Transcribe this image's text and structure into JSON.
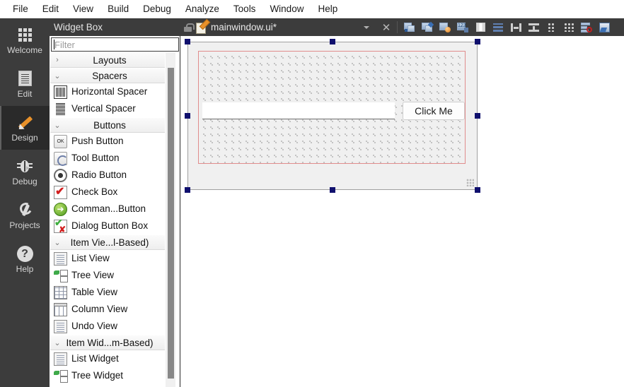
{
  "menubar": {
    "items": [
      {
        "label": "File"
      },
      {
        "label": "Edit"
      },
      {
        "label": "View"
      },
      {
        "label": "Build"
      },
      {
        "label": "Debug"
      },
      {
        "label": "Analyze"
      },
      {
        "label": "Tools"
      },
      {
        "label": "Window"
      },
      {
        "label": "Help"
      }
    ]
  },
  "modebar": {
    "items": [
      {
        "label": "Welcome",
        "icon": "grid-icon",
        "active": false
      },
      {
        "label": "Edit",
        "icon": "document-icon",
        "active": false
      },
      {
        "label": "Design",
        "icon": "pencil-icon",
        "active": true
      },
      {
        "label": "Debug",
        "icon": "bug-icon",
        "active": false
      },
      {
        "label": "Projects",
        "icon": "wrench-icon",
        "active": false
      },
      {
        "label": "Help",
        "icon": "question-mark-icon",
        "active": false
      }
    ]
  },
  "widgetbox": {
    "title": "Widget Box",
    "filter_placeholder": "Filter",
    "filter_value": "",
    "entries": [
      {
        "kind": "section",
        "label": "Layouts",
        "expanded": false,
        "chevron": "›"
      },
      {
        "kind": "section",
        "label": "Spacers",
        "expanded": true,
        "chevron": "⌄"
      },
      {
        "kind": "item",
        "label": "Horizontal Spacer",
        "icon": "horizontal-spacer-icon"
      },
      {
        "kind": "item",
        "label": "Vertical Spacer",
        "icon": "vertical-spacer-icon"
      },
      {
        "kind": "section",
        "label": "Buttons",
        "expanded": true,
        "chevron": "⌄"
      },
      {
        "kind": "item",
        "label": "Push Button",
        "icon": "push-button-icon"
      },
      {
        "kind": "item",
        "label": "Tool Button",
        "icon": "tool-button-icon"
      },
      {
        "kind": "item",
        "label": "Radio Button",
        "icon": "radio-button-icon"
      },
      {
        "kind": "item",
        "label": "Check Box",
        "icon": "check-box-icon"
      },
      {
        "kind": "item",
        "label": "Comman...Button",
        "icon": "command-link-button-icon"
      },
      {
        "kind": "item",
        "label": "Dialog Button Box",
        "icon": "dialog-button-box-icon"
      },
      {
        "kind": "section",
        "label": "Item Vie...l-Based)",
        "expanded": true,
        "chevron": "⌄"
      },
      {
        "kind": "item",
        "label": "List View",
        "icon": "list-view-icon"
      },
      {
        "kind": "item",
        "label": "Tree View",
        "icon": "tree-view-icon"
      },
      {
        "kind": "item",
        "label": "Table View",
        "icon": "table-view-icon"
      },
      {
        "kind": "item",
        "label": "Column View",
        "icon": "column-view-icon"
      },
      {
        "kind": "item",
        "label": "Undo View",
        "icon": "undo-view-icon"
      },
      {
        "kind": "section",
        "label": "Item Wid...m-Based)",
        "expanded": true,
        "chevron": "⌄"
      },
      {
        "kind": "item",
        "label": "List Widget",
        "icon": "list-widget-icon"
      },
      {
        "kind": "item",
        "label": "Tree Widget",
        "icon": "tree-widget-icon"
      }
    ]
  },
  "editor": {
    "tab": {
      "filename": "mainwindow.ui*",
      "lock_icon": "unlocked-padlock-icon",
      "file_icon": "ui-file-icon",
      "dropdown_icon": "chevron-down-icon",
      "close_label": "✕"
    },
    "toolbar": [
      {
        "name": "adjust-size-icon",
        "title": "Adjust Size"
      },
      {
        "name": "lay-out-horizontally-icon",
        "title": "Lay Out Horizontally"
      },
      {
        "name": "lay-out-vertically-icon",
        "title": "Lay Out Vertically"
      },
      {
        "name": "lay-out-in-grid-icon",
        "title": "Lay Out in a Grid"
      },
      {
        "name": "lay-out-horizontally-in-splitter-icon",
        "title": "Lay Out Horizontally in Splitter"
      },
      {
        "name": "lay-out-vertically-in-splitter-icon",
        "title": "Lay Out Vertically in Splitter"
      },
      {
        "name": "lay-out-form-layout-icon",
        "title": "Lay Out in a Form Layout"
      },
      {
        "name": "break-layout-icon",
        "title": "Break Layout"
      },
      {
        "name": "simplify-grid-layout-icon",
        "title": "Simplify Grid Layout"
      },
      {
        "name": "edit-buddies-icon",
        "title": "Edit Buddies"
      },
      {
        "name": "edit-tab-order-icon",
        "title": "Edit Tab Order"
      },
      {
        "name": "edit-signals-slots-icon",
        "title": "Edit Signals/Slots"
      },
      {
        "name": "preview-form-icon",
        "title": "Preview Form"
      }
    ]
  },
  "form": {
    "line_edit_value": "",
    "button_label": "Click Me",
    "selected": true,
    "layout_outline_color": "#e08c8c",
    "handle_color": "#10106e",
    "background_color": "#f0f0f0",
    "size_grip_icon": "size-grip-icon"
  }
}
